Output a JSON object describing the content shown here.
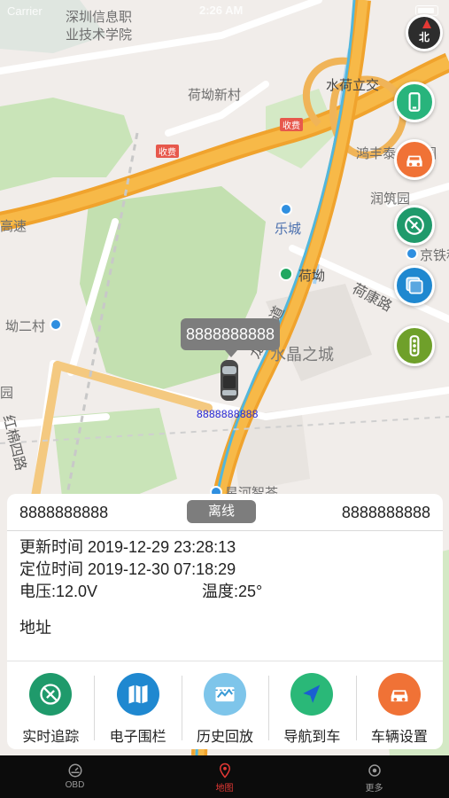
{
  "status_bar": {
    "carrier": "Carrier",
    "time": "2:26 AM"
  },
  "map": {
    "labels": {
      "school": "深圳信息职",
      "school2": "业技术学院",
      "village_heao": "荷坳新村",
      "interchange": "水荷立交",
      "hongfeng": "鸿丰泰",
      "hongfeng_tail": "园",
      "runzhu": "润筑园",
      "lecheng": "乐城",
      "metro_heao": "荷坳",
      "jingtie": "京铁科",
      "hekang_road": "荷康路",
      "longgang_road": "龙岗大道",
      "shuijing": "水晶之城",
      "aoer_village": "坳二村",
      "hongmian_road": "红棉四路",
      "highway": "高速",
      "yuan": "园",
      "xingaoyuan": "星河智荟",
      "toll1": "收费",
      "toll2": "收费"
    }
  },
  "vehicle": {
    "bubble_id": "8888888888",
    "plate_label": "8888888888"
  },
  "card": {
    "id_left": "8888888888",
    "status": "离线",
    "id_right": "8888888888",
    "update_time": "更新时间 2019-12-29 23:28:13",
    "locate_time": "定位时间 2019-12-30 07:18:29",
    "voltage": "电压:12.0V",
    "temperature": "温度:25°",
    "address": "地址"
  },
  "actions": [
    {
      "label": "实时追踪",
      "icon": "track-icon",
      "color": "#1f9a6b"
    },
    {
      "label": "电子围栏",
      "icon": "map-fence-icon",
      "color": "#1f88d0"
    },
    {
      "label": "历史回放",
      "icon": "history-playback-icon",
      "color": "#7ec5ea"
    },
    {
      "label": "导航到车",
      "icon": "navigation-icon",
      "color": "#2ab878"
    },
    {
      "label": "车辆设置",
      "icon": "car-settings-icon",
      "color": "#f07236"
    }
  ],
  "tabs": [
    {
      "label": "OBD",
      "icon": "obd-icon"
    },
    {
      "label": "地图",
      "icon": "map-icon"
    },
    {
      "label": "更多",
      "icon": "more-icon"
    }
  ],
  "compass_label": "北",
  "colors": {
    "side_phone": "#28b47c",
    "side_car": "#f07236",
    "side_track": "#1f9a6b",
    "side_layers": "#1f88d0",
    "side_traffic": "#6fa02a",
    "active_tab": "#e53935"
  }
}
